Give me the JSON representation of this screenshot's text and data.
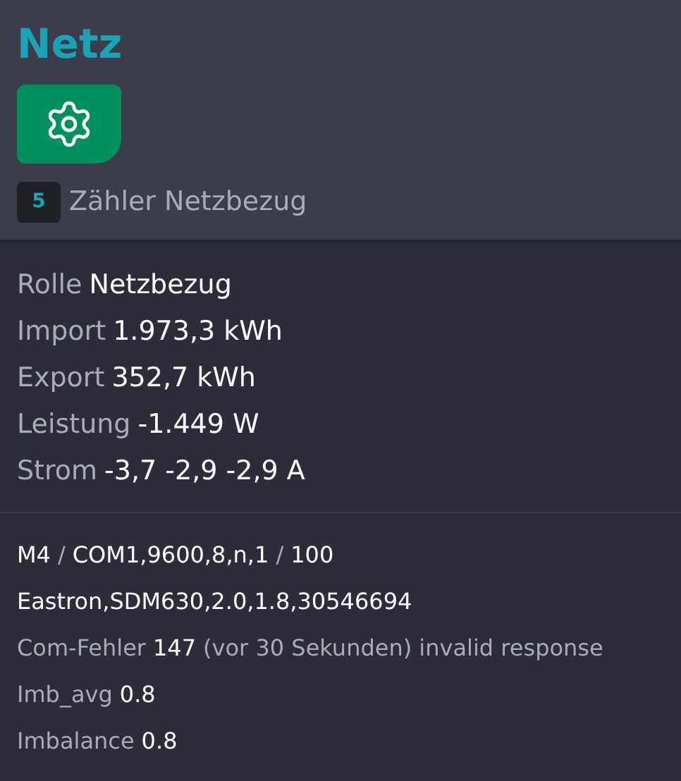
{
  "title": "Netz",
  "settings_button": {
    "kind": "gear"
  },
  "meter": {
    "number": "5",
    "name": "Zähler Netzbezug"
  },
  "readings": [
    {
      "segments": [
        {
          "kind": "label",
          "text": "Rolle"
        },
        {
          "kind": "value",
          "text": "Netzbezug"
        }
      ]
    },
    {
      "segments": [
        {
          "kind": "label",
          "text": "Import"
        },
        {
          "kind": "value",
          "text": "1.973,3 kWh"
        }
      ]
    },
    {
      "segments": [
        {
          "kind": "label",
          "text": "Export"
        },
        {
          "kind": "value",
          "text": "352,7 kWh"
        }
      ]
    },
    {
      "segments": [
        {
          "kind": "label",
          "text": "Leistung"
        },
        {
          "kind": "value",
          "text": "-1.449 W"
        }
      ]
    },
    {
      "segments": [
        {
          "kind": "label",
          "text": "Strom"
        },
        {
          "kind": "value",
          "text": "-3,7 -2,9 -2,9 A"
        }
      ]
    }
  ],
  "details": [
    {
      "segments": [
        {
          "kind": "value",
          "text": "M4"
        },
        {
          "kind": "label",
          "text": "/"
        },
        {
          "kind": "value",
          "text": "COM1,9600,8,n,1"
        },
        {
          "kind": "label",
          "text": "/"
        },
        {
          "kind": "value",
          "text": "100"
        }
      ]
    },
    {
      "segments": [
        {
          "kind": "value",
          "text": "Eastron,SDM630,2.0,1.8,30546694"
        }
      ]
    },
    {
      "segments": [
        {
          "kind": "label",
          "text": "Com-Fehler"
        },
        {
          "kind": "value",
          "text": "147"
        },
        {
          "kind": "label",
          "text": "(vor 30 Sekunden) invalid response"
        }
      ]
    },
    {
      "segments": [
        {
          "kind": "label",
          "text": "Imb_avg"
        },
        {
          "kind": "value",
          "text": "0.8"
        }
      ]
    },
    {
      "segments": [
        {
          "kind": "label",
          "text": "Imbalance"
        },
        {
          "kind": "value",
          "text": "0.8"
        }
      ]
    }
  ]
}
